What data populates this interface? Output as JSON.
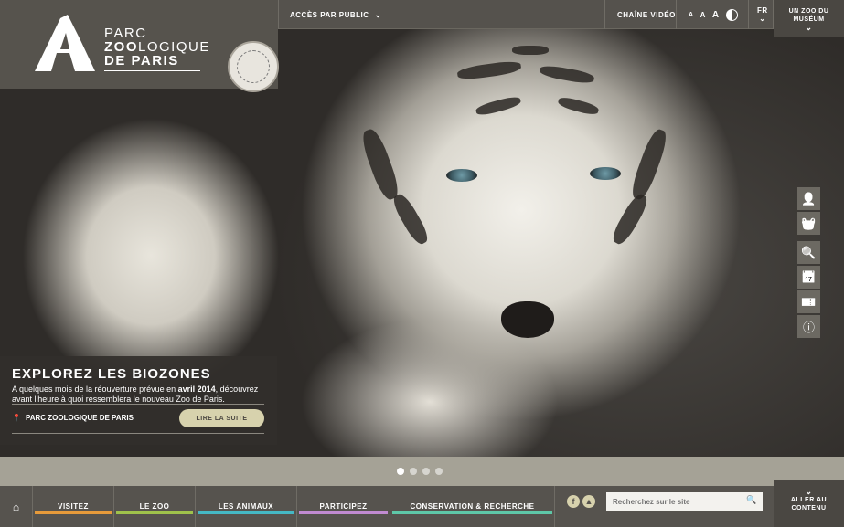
{
  "logo": {
    "line1": "PARC",
    "line2_bold": "ZOO",
    "line2_rest": "LOGIQUE",
    "line3": "DE PARIS"
  },
  "topbar": {
    "public_access": "ACCÈS PAR PUBLIC",
    "video": "CHAÎNE VIDÉO",
    "font_small": "A",
    "font_mid": "A",
    "font_large": "A",
    "lang": "FR",
    "museum_line1": "UN ZOO DU",
    "museum_line2": "MUSÉUM"
  },
  "side_icons": [
    {
      "name": "user-icon",
      "glyph": "👤"
    },
    {
      "name": "basket-icon",
      "glyph": "🧺"
    },
    {
      "name": "search-icon",
      "glyph": "🔍"
    },
    {
      "name": "calendar-icon",
      "glyph": "📅"
    },
    {
      "name": "ticket-icon",
      "glyph": "🎫"
    },
    {
      "name": "info-icon",
      "glyph": "ⓘ"
    }
  ],
  "caption": {
    "title": "EXPLOREZ LES BIOZONES",
    "text_before": "A quelques mois de la réouverture prévue en ",
    "text_bold": "avril 2014",
    "text_after": ", découvrez avant l'heure à quoi ressemblera le nouveau Zoo de Paris.",
    "location": "PARC ZOOLOGIQUE DE PARIS",
    "button": "LIRE LA SUITE"
  },
  "slider": {
    "total": 4,
    "active": 1
  },
  "nav": {
    "items": [
      {
        "label": "VISITEZ",
        "color": "#e69a3a"
      },
      {
        "label": "LE ZOO",
        "color": "#9fc24b"
      },
      {
        "label": "LES ANIMAUX",
        "color": "#45b8c4"
      },
      {
        "label": "PARTICIPEZ",
        "color": "#c18bd1"
      },
      {
        "label": "CONSERVATION & RECHERCHE",
        "color": "#5ec7a8"
      }
    ],
    "search_placeholder": "Recherchez sur le site",
    "content_line1": "ALLER AU",
    "content_line2": "CONTENU"
  }
}
